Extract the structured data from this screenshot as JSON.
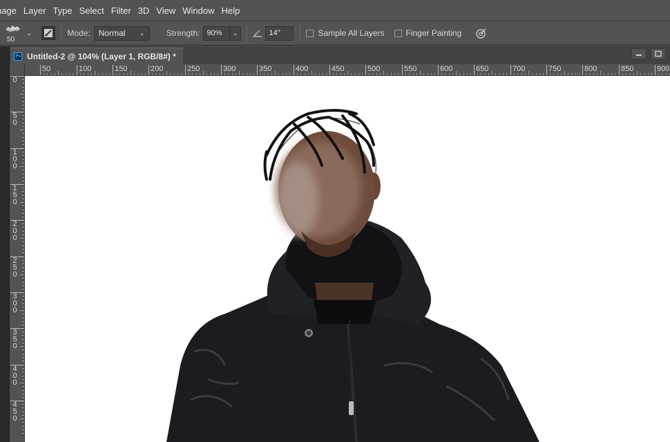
{
  "menubar": {
    "items": [
      "nage",
      "Layer",
      "Type",
      "Select",
      "Filter",
      "3D",
      "View",
      "Window",
      "Help"
    ]
  },
  "options": {
    "brush_size": "50",
    "mode_label": "Mode:",
    "mode_value": "Normal",
    "strength_label": "Strength:",
    "strength_value": "90%",
    "angle_value": "14°",
    "sample_all_layers": "Sample All Layers",
    "finger_painting": "Finger Painting",
    "sample_all_layers_checked": false,
    "finger_painting_checked": false
  },
  "document": {
    "tab_title": "Untitled-2 @ 104% (Layer 1, RGB/8#) *",
    "app_badge": "Ps"
  },
  "ruler": {
    "h_labels": [
      "50",
      "100",
      "150",
      "200",
      "250",
      "300",
      "350",
      "400",
      "450",
      "500",
      "550",
      "600",
      "650",
      "700",
      "750",
      "800",
      "850",
      "900"
    ],
    "v_labels": [
      "0",
      "50",
      "100",
      "150",
      "200",
      "250",
      "300",
      "350",
      "400",
      "450"
    ]
  },
  "icons": {
    "brush_preset": "brush-preset-icon",
    "toggle_panel": "brush-settings-icon",
    "angle": "angle-icon",
    "pressure": "pressure-icon",
    "minimize": "minimize-icon",
    "maximize": "maximize-icon"
  },
  "colors": {
    "app_bg": "#535353",
    "canvas": "#ffffff",
    "ps_accent": "#31a8ff"
  }
}
